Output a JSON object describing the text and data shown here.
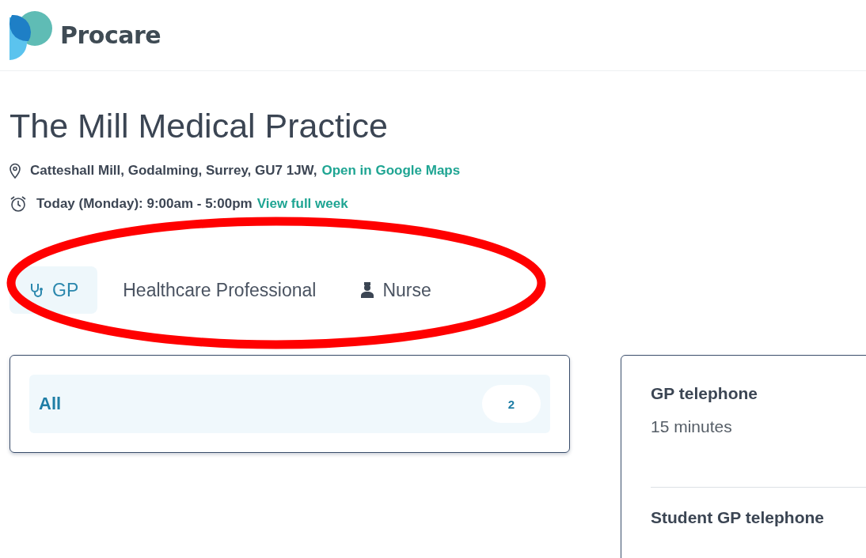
{
  "header": {
    "logo_text": "Procare"
  },
  "practice": {
    "name": "The Mill Medical Practice",
    "address": "Catteshall Mill, Godalming, Surrey, GU7 1JW,",
    "maps_link": "Open in Google Maps",
    "hours": "Today (Monday): 9:00am - 5:00pm",
    "week_link": "View full week"
  },
  "tabs": [
    {
      "label": "GP",
      "selected": true,
      "kind": "stethoscope"
    },
    {
      "label": "Healthcare Professional",
      "selected": false,
      "kind": "plain"
    },
    {
      "label": "Nurse",
      "selected": false,
      "kind": "nurse"
    }
  ],
  "filters": [
    {
      "label": "All",
      "count": "2",
      "selected": true
    }
  ],
  "appointments": [
    {
      "name": "GP telephone",
      "duration": "15 minutes"
    },
    {
      "name": "Student GP telephone"
    }
  ]
}
